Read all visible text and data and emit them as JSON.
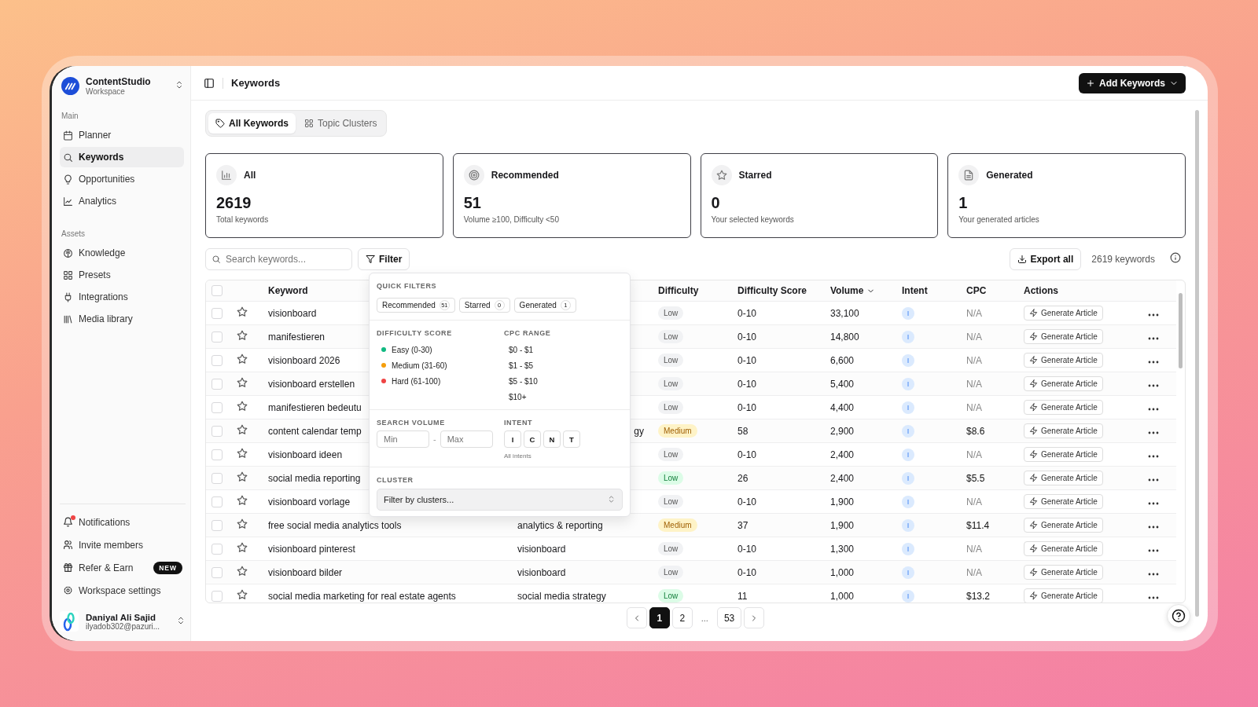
{
  "sidebar": {
    "workspace": {
      "name": "ContentStudio",
      "subtitle": "Workspace"
    },
    "sections": [
      {
        "label": "Main",
        "items": [
          {
            "label": "Planner",
            "selected": false
          },
          {
            "label": "Keywords",
            "selected": true
          },
          {
            "label": "Opportunities",
            "selected": false
          },
          {
            "label": "Analytics",
            "selected": false
          }
        ]
      },
      {
        "label": "Assets",
        "items": [
          {
            "label": "Knowledge",
            "selected": false
          },
          {
            "label": "Presets",
            "selected": false
          },
          {
            "label": "Integrations",
            "selected": false
          },
          {
            "label": "Media library",
            "selected": false
          }
        ]
      }
    ],
    "footer_items": [
      {
        "label": "Notifications",
        "unread": true
      },
      {
        "label": "Invite members",
        "unread": false
      },
      {
        "label": "Refer & Earn",
        "unread": false,
        "badge": "NEW"
      },
      {
        "label": "Workspace settings",
        "unread": false
      }
    ],
    "user": {
      "name": "Daniyal Ali Sajid",
      "email": "ilyadob302@pazuri..."
    }
  },
  "header": {
    "title": "Keywords",
    "primary_button": "Add Keywords"
  },
  "tabs": [
    {
      "label": "All Keywords",
      "selected": true
    },
    {
      "label": "Topic Clusters",
      "selected": false
    }
  ],
  "stats": [
    {
      "title": "All",
      "value": "2619",
      "caption": "Total keywords"
    },
    {
      "title": "Recommended",
      "value": "51",
      "caption": "Volume ≥100, Difficulty <50"
    },
    {
      "title": "Starred",
      "value": "0",
      "caption": "Your selected keywords"
    },
    {
      "title": "Generated",
      "value": "1",
      "caption": "Your generated articles"
    }
  ],
  "toolbar": {
    "search": {
      "placeholder": "Search keywords..."
    },
    "filter_button": "Filter",
    "export_button": "Export all",
    "count": "2619 keywords"
  },
  "filter_panel": {
    "quick_filters": {
      "title": "QUICK FILTERS",
      "chips": [
        {
          "label": "Recommended",
          "count": "51",
          "selected": false
        },
        {
          "label": "Starred",
          "count": "0",
          "selected": false
        },
        {
          "label": "Generated",
          "count": "1",
          "selected": false
        }
      ]
    },
    "difficulty": {
      "title": "DIFFICULTY SCORE",
      "options": [
        {
          "label": "Easy (0-30)",
          "color": "#10b981"
        },
        {
          "label": "Medium (31-60)",
          "color": "#f59e0b"
        },
        {
          "label": "Hard (61-100)",
          "color": "#ef4444"
        }
      ]
    },
    "cpc": {
      "title": "CPC RANGE",
      "options": [
        "$0 - $1",
        "$1 - $5",
        "$5 - $10",
        "$10+"
      ]
    },
    "volume": {
      "title": "SEARCH VOLUME",
      "min": {
        "placeholder": "Min"
      },
      "separator": "-",
      "max": {
        "placeholder": "Max"
      }
    },
    "intent": {
      "title": "INTENT",
      "options": [
        {
          "label": "I",
          "selected": false
        },
        {
          "label": "C",
          "selected": false
        },
        {
          "label": "N",
          "selected": false
        },
        {
          "label": "T",
          "selected": false
        }
      ],
      "hint": "All intents"
    },
    "cluster": {
      "title": "CLUSTER",
      "select": {
        "placeholder": "Filter by clusters..."
      }
    }
  },
  "table": {
    "all_checked": false,
    "columns": [
      {
        "label": "Keyword"
      },
      {
        "label": "Difficulty"
      },
      {
        "label": "Difficulty Score"
      },
      {
        "label": "Volume",
        "sorted": true
      },
      {
        "label": "Intent"
      },
      {
        "label": "CPC"
      },
      {
        "label": "Actions"
      }
    ],
    "rows": [
      {
        "checked": false,
        "starred": false,
        "keyword": "visionboard",
        "difficulty": {
          "label": "Low",
          "color": "#f1f2f4"
        },
        "score": "0-10",
        "volume": "33,100",
        "intent": "I",
        "cpc": "N/A",
        "cpc_available": false,
        "action": "Generate Article"
      },
      {
        "checked": false,
        "starred": false,
        "keyword": "manifestieren",
        "difficulty": {
          "label": "Low",
          "color": "#f1f2f4"
        },
        "score": "0-10",
        "volume": "14,800",
        "intent": "I",
        "cpc": "N/A",
        "cpc_available": false,
        "action": "Generate Article"
      },
      {
        "checked": false,
        "starred": false,
        "keyword": "visionboard 2026",
        "difficulty": {
          "label": "Low",
          "color": "#f1f2f4"
        },
        "score": "0-10",
        "volume": "6,600",
        "intent": "I",
        "cpc": "N/A",
        "cpc_available": false,
        "action": "Generate Article"
      },
      {
        "checked": false,
        "starred": false,
        "keyword": "visionboard erstellen",
        "difficulty": {
          "label": "Low",
          "color": "#f1f2f4"
        },
        "score": "0-10",
        "volume": "5,400",
        "intent": "I",
        "cpc": "N/A",
        "cpc_available": false,
        "action": "Generate Article"
      },
      {
        "checked": false,
        "starred": false,
        "keyword": "manifestieren bedeutu",
        "difficulty": {
          "label": "Low",
          "color": "#f1f2f4"
        },
        "score": "0-10",
        "volume": "4,400",
        "intent": "I",
        "cpc": "N/A",
        "cpc_available": false,
        "action": "Generate Article"
      },
      {
        "checked": false,
        "starred": false,
        "keyword": "content calendar temp",
        "cluster": "gy",
        "cluster_clipped": true,
        "difficulty": {
          "label": "Medium",
          "color": "#fef3c7"
        },
        "score": "58",
        "volume": "2,900",
        "intent": "I",
        "cpc": "$8.6",
        "cpc_available": true,
        "action": "Generate Article"
      },
      {
        "checked": false,
        "starred": false,
        "keyword": "visionboard ideen",
        "difficulty": {
          "label": "Low",
          "color": "#f1f2f4"
        },
        "score": "0-10",
        "volume": "2,400",
        "intent": "I",
        "cpc": "N/A",
        "cpc_available": false,
        "action": "Generate Article"
      },
      {
        "checked": false,
        "starred": false,
        "keyword": "social media reporting",
        "difficulty": {
          "label": "Low",
          "color": "#dcfce7"
        },
        "score": "26",
        "volume": "2,400",
        "intent": "I",
        "cpc": "$5.5",
        "cpc_available": true,
        "action": "Generate Article"
      },
      {
        "checked": false,
        "starred": false,
        "keyword": "visionboard vorlage",
        "difficulty": {
          "label": "Low",
          "color": "#f1f2f4"
        },
        "score": "0-10",
        "volume": "1,900",
        "intent": "I",
        "cpc": "N/A",
        "cpc_available": false,
        "action": "Generate Article"
      },
      {
        "checked": false,
        "starred": false,
        "keyword": "free social media analytics tools",
        "cluster": "analytics & reporting",
        "cluster_clipped": false,
        "difficulty": {
          "label": "Medium",
          "color": "#fef3c7"
        },
        "score": "37",
        "volume": "1,900",
        "intent": "I",
        "cpc": "$11.4",
        "cpc_available": true,
        "action": "Generate Article"
      },
      {
        "checked": false,
        "starred": false,
        "keyword": "visionboard pinterest",
        "cluster": "visionboard",
        "cluster_clipped": false,
        "difficulty": {
          "label": "Low",
          "color": "#f1f2f4"
        },
        "score": "0-10",
        "volume": "1,300",
        "intent": "I",
        "cpc": "N/A",
        "cpc_available": false,
        "action": "Generate Article"
      },
      {
        "checked": false,
        "starred": false,
        "keyword": "visionboard bilder",
        "cluster": "visionboard",
        "cluster_clipped": false,
        "difficulty": {
          "label": "Low",
          "color": "#f1f2f4"
        },
        "score": "0-10",
        "volume": "1,000",
        "intent": "I",
        "cpc": "N/A",
        "cpc_available": false,
        "action": "Generate Article"
      },
      {
        "checked": false,
        "starred": false,
        "keyword": "social media marketing for real estate agents",
        "cluster": "social media strategy",
        "cluster_clipped": false,
        "difficulty": {
          "label": "Low",
          "color": "#dcfce7"
        },
        "score": "11",
        "volume": "1,000",
        "intent": "I",
        "cpc": "$13.2",
        "cpc_available": true,
        "action": "Generate Article"
      }
    ]
  },
  "pagination": {
    "pages": [
      {
        "label": "1",
        "kind": "page",
        "selected": true
      },
      {
        "label": "2",
        "kind": "page",
        "selected": false
      },
      {
        "label": "...",
        "kind": "ellipsis"
      },
      {
        "label": "53",
        "kind": "page",
        "selected": false
      }
    ]
  }
}
